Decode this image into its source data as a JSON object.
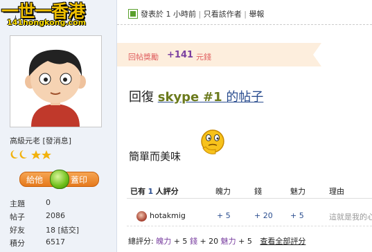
{
  "logo": {
    "chinese": "一世一香港",
    "english": "141hongkong.com",
    "person_label": "人"
  },
  "user": {
    "rank": "高級元老",
    "message_link": "[發消息]",
    "gift_left": "給他",
    "gift_right": "蓋印",
    "stats": [
      {
        "label": "主題",
        "value": "0"
      },
      {
        "label": "帖子",
        "value": "2086"
      },
      {
        "label": "好友",
        "value": "18 [結交]"
      },
      {
        "label": "積分",
        "value": "6517"
      }
    ]
  },
  "post": {
    "posted": "發表於 1 小時前",
    "only_author": "只看該作者",
    "report": "舉報",
    "reward_label": "回帖獎勵",
    "reward_amount": "+141",
    "reward_unit": "元錢",
    "reply_prefix": "回復",
    "reply_user": "skype",
    "reply_floor": "#1",
    "reply_suffix": "的帖子",
    "body": "簡單而美味"
  },
  "rating": {
    "header_prefix": "已有",
    "count": "1",
    "header_suffix": "人評分",
    "columns": [
      "魄力",
      "錢",
      "魅力",
      "理由"
    ],
    "rows": [
      {
        "user": "hotakmig",
        "values": [
          "+ 5",
          "+ 20",
          "+ 5"
        ],
        "reason": "這就是我的心"
      }
    ],
    "summary_prefix": "總評分:",
    "summary_items": [
      {
        "k": "魄力",
        "v": "+ 5"
      },
      {
        "k": "錢",
        "v": "+ 20"
      },
      {
        "k": "魅力",
        "v": "+ 5"
      }
    ],
    "view_all": "查看全部評分"
  },
  "colors": {
    "sidebar_bg": "#eef2f8",
    "reward_bg": "#fdeedd",
    "reward_text": "#e06060",
    "reward_amount": "#7a3fa0",
    "link": "#2a4d8f",
    "gift_button": "#e5791c"
  }
}
